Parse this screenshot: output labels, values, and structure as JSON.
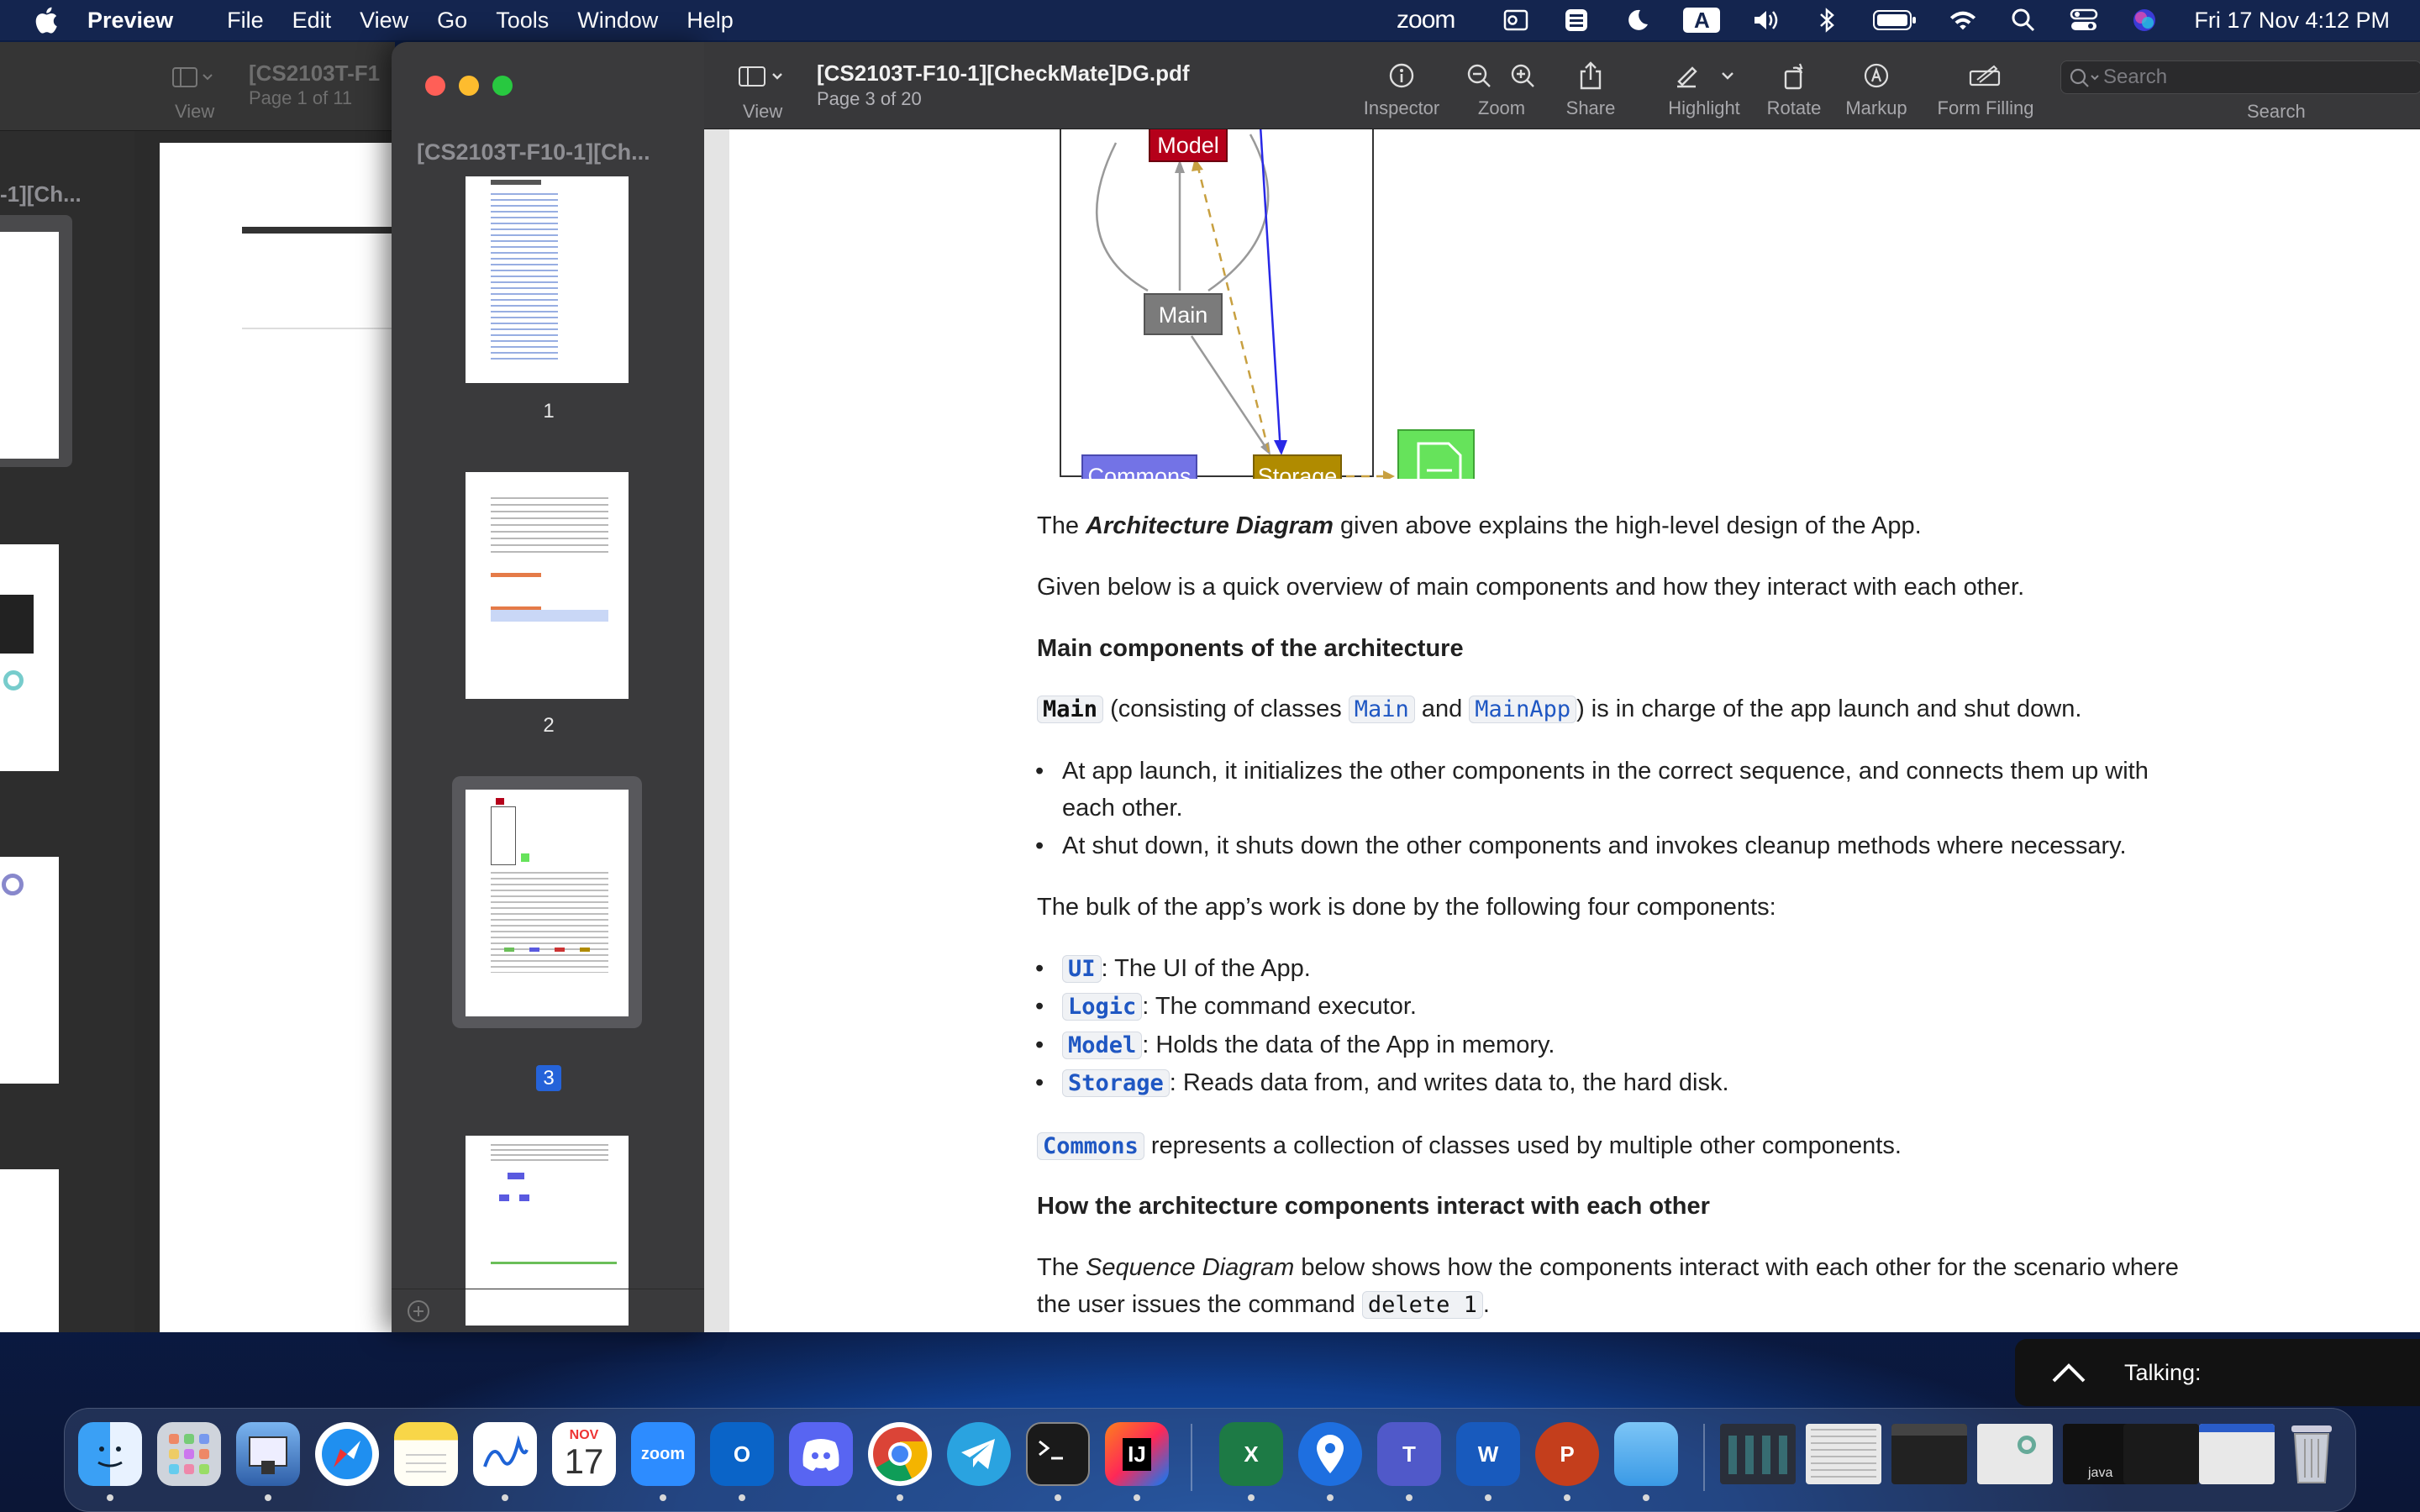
{
  "menubar": {
    "app_name": "Preview",
    "menus": [
      "File",
      "Edit",
      "View",
      "Go",
      "Tools",
      "Window",
      "Help"
    ],
    "zoom_label": "zoom",
    "input_source": "A",
    "datetime": "Fri 17 Nov  4:12 PM"
  },
  "bg_window": {
    "title": "[CS2103T-F1",
    "page_info": "Page 1 of 11",
    "view_label": "View",
    "sidebar_title": "-1][Ch..."
  },
  "sidebar": {
    "title": "[CS2103T-F10-1][Ch...",
    "thumbnails": [
      {
        "label": "1",
        "selected": false
      },
      {
        "label": "2",
        "selected": false
      },
      {
        "label": "3",
        "selected": true
      },
      {
        "label": "",
        "selected": false
      }
    ]
  },
  "toolbar": {
    "view_label": "View",
    "doc_title": "[CS2103T-F10-1][CheckMate]DG.pdf",
    "page_info": "Page 3 of 20",
    "tools": {
      "inspector": "Inspector",
      "zoom": "Zoom",
      "share": "Share",
      "highlight": "Highlight",
      "rotate": "Rotate",
      "markup": "Markup",
      "form_filling": "Form Filling"
    },
    "search_placeholder": "Search",
    "search_label": "Search"
  },
  "diagram": {
    "nodes": {
      "model": "Model",
      "main": "Main",
      "commons": "Commons",
      "storage": "Storage"
    },
    "colors": {
      "model": "#b5001a",
      "main": "#7b7b7b",
      "commons": "#7373e6",
      "storage": "#b08b00",
      "file": "#66e35b"
    }
  },
  "doc": {
    "p1_pre": "The ",
    "p1_em": "Architecture Diagram",
    "p1_post": " given above explains the high-level design of the App.",
    "p2": "Given below is a quick overview of main components and how they interact with each other.",
    "h1": "Main components of the architecture",
    "main_code": "Main",
    "main_text1": " (consisting of classes ",
    "main_class1": "Main",
    "main_and": " and ",
    "main_class2": "MainApp",
    "main_text2": ") is in charge of the app launch and shut down.",
    "bullet1_line1": "At app launch, it initializes the other components in the correct sequence, and connects them up with",
    "bullet1_line2": "each other.",
    "bullet2": "At shut down, it shuts down the other components and invokes cleanup methods where necessary.",
    "p3": "The bulk of the app’s work is done by the following four components:",
    "components": [
      {
        "code": "UI",
        "desc": ": The UI of the App."
      },
      {
        "code": "Logic",
        "desc": ": The command executor."
      },
      {
        "code": "Model",
        "desc": ": Holds the data of the App in memory."
      },
      {
        "code": "Storage",
        "desc": ": Reads data from, and writes data to, the hard disk."
      }
    ],
    "commons_code": "Commons",
    "commons_text": " represents a collection of classes used by multiple other components.",
    "h2": "How the architecture components interact with each other",
    "p4_pre": "The ",
    "p4_em": "Sequence Diagram",
    "p4_post": " below shows how the components interact with each other for the scenario where",
    "p5_pre": "the user issues the command ",
    "p5_code": "delete 1",
    "p5_post": "."
  },
  "toast": {
    "label": "Talking:"
  },
  "dock": {
    "calendar_month": "NOV",
    "calendar_day": "17",
    "zoom_label": "zoom",
    "intellij_label": "IJ",
    "excel_label": "X",
    "word_label": "W",
    "ppt_label": "P",
    "teams_label": "T",
    "outlook_label": "O",
    "java_label": "java"
  }
}
